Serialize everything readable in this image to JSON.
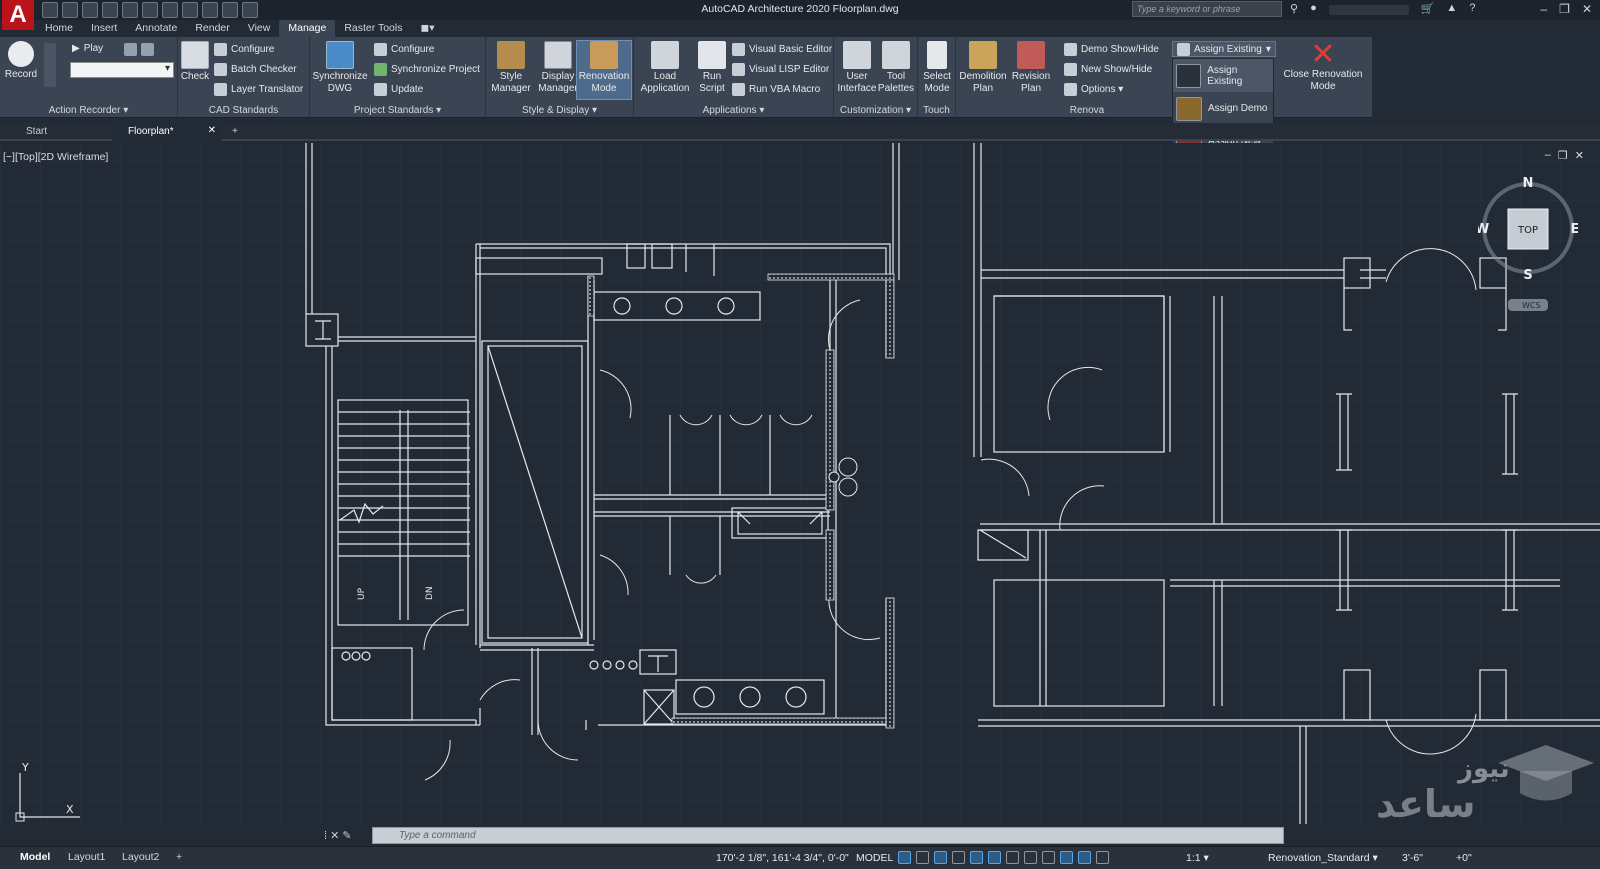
{
  "app": {
    "logo": "A",
    "title": "AutoCAD Architecture 2020   Floorplan.dwg",
    "search_placeholder": "Type a keyword or phrase"
  },
  "window_controls": [
    "–",
    "❐",
    "✕"
  ],
  "ribbon_tabs": [
    "Home",
    "Insert",
    "Annotate",
    "Render",
    "View",
    "Manage",
    "Raster Tools"
  ],
  "active_tab": "Manage",
  "panels": {
    "action_recorder": {
      "title": "Action Recorder ▾",
      "record": "Record",
      "play": "Play"
    },
    "cad_standards": {
      "title": "CAD Standards",
      "check": "Check",
      "configure": "Configure",
      "batch_checker": "Batch Checker",
      "layer_translator": "Layer Translator"
    },
    "project_standards": {
      "title": "Project Standards ▾",
      "sync_dwg": "Synchronize DWG",
      "configure": "Configure",
      "sync_project": "Synchronize Project",
      "update": "Update"
    },
    "style_display": {
      "title": "Style & Display ▾",
      "style_manager": "Style Manager",
      "display_manager": "Display Manager",
      "renovation_mode": "Renovation Mode"
    },
    "applications": {
      "title": "Applications ▾",
      "load_app": "Load Application",
      "run_script": "Run Script",
      "vba_editor": "Visual Basic Editor",
      "lisp_editor": "Visual LISP Editor",
      "vba_macro": "Run VBA Macro"
    },
    "customization": {
      "title": "Customization ▾",
      "ui": "User Interface",
      "tool_palettes": "Tool Palettes"
    },
    "touch": {
      "title": "Touch",
      "select_mode": "Select Mode"
    },
    "renovation": {
      "title": "Renova",
      "demolition_plan": "Demolition Plan",
      "revision_plan": "Revision Plan",
      "demo_show": "Demo Show/Hide",
      "new_show": "New Show/Hide",
      "options": "Options ▾",
      "assign_existing_combo": "Assign Existing",
      "close": "Close Renovation Mode"
    }
  },
  "dropdown": [
    "Assign Existing",
    "Assign Demo",
    "Assign New"
  ],
  "file_tabs": [
    "Start",
    "Floorplan*"
  ],
  "viewport": {
    "label": "[−][Top][2D Wireframe]",
    "stair_up": "UP",
    "stair_dn": "DN"
  },
  "viewcube": {
    "n": "N",
    "s": "S",
    "e": "E",
    "w": "W",
    "top": "TOP",
    "wcs": "WCS"
  },
  "ucs": {
    "x": "X",
    "y": "Y"
  },
  "command": {
    "placeholder": "Type a command"
  },
  "layout_tabs": [
    "Model",
    "Layout1",
    "Layout2"
  ],
  "status": {
    "coords": "170'-2 1/8\", 161'-4 3/4\", 0'-0\"",
    "model": "MODEL",
    "scale": "1:1 ▾",
    "standard": "Renovation_Standard ▾",
    "dim": "3'-6\"",
    "add": "+0\""
  },
  "watermark": {
    "line1": "نیوز",
    "line2": "ساعد"
  },
  "colors": {
    "bg": "#222a35",
    "ribbon": "#3b4453",
    "logo": "#b9131b",
    "close_x": "#e03c3c",
    "line": "#e6e8ea"
  }
}
